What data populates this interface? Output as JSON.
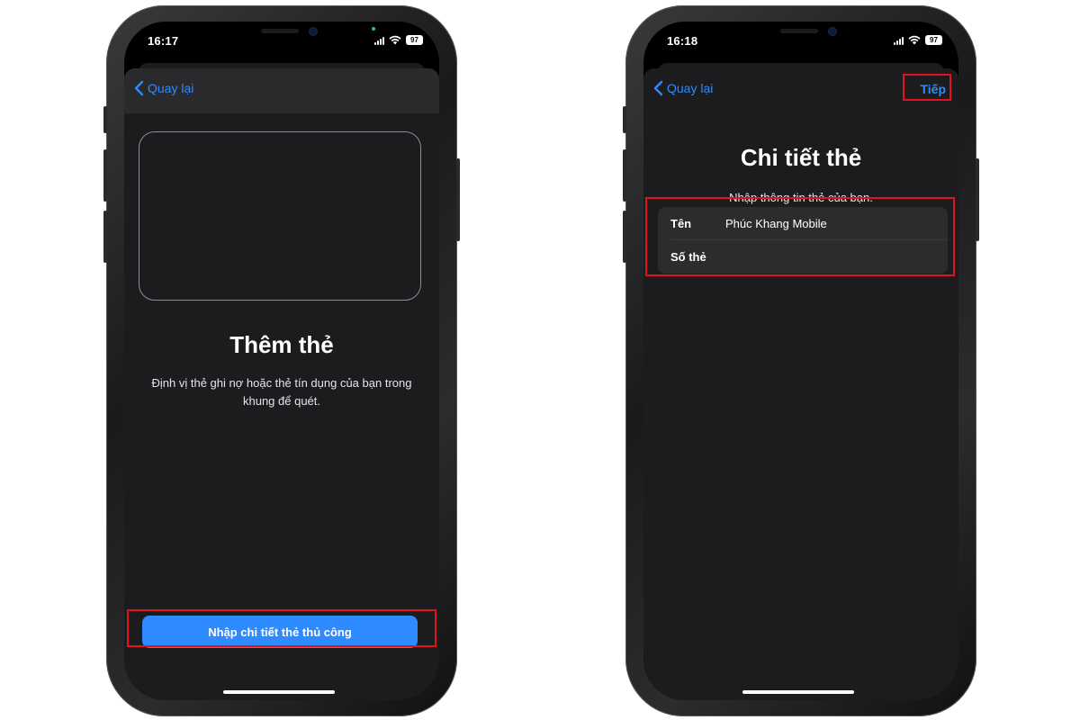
{
  "left_phone": {
    "status_time": "16:17",
    "battery": "97",
    "back_label": "Quay lại",
    "title": "Thêm thẻ",
    "subtitle": "Định vị thẻ ghi nợ hoặc thẻ tín dụng của bạn trong khung để quét.",
    "manual_button_label": "Nhập chi tiết thẻ thủ công"
  },
  "right_phone": {
    "status_time": "16:18",
    "battery": "97",
    "back_label": "Quay lại",
    "next_label": "Tiếp",
    "title": "Chi tiết thẻ",
    "subtitle": "Nhập thông tin thẻ của bạn.",
    "fields": [
      {
        "label": "Tên",
        "value": "Phúc Khang Mobile"
      },
      {
        "label": "Số thẻ",
        "value": ""
      }
    ]
  },
  "colors": {
    "accent": "#2e8bff",
    "highlight": "#e0141c",
    "sheet_bg": "#1c1c1e"
  }
}
